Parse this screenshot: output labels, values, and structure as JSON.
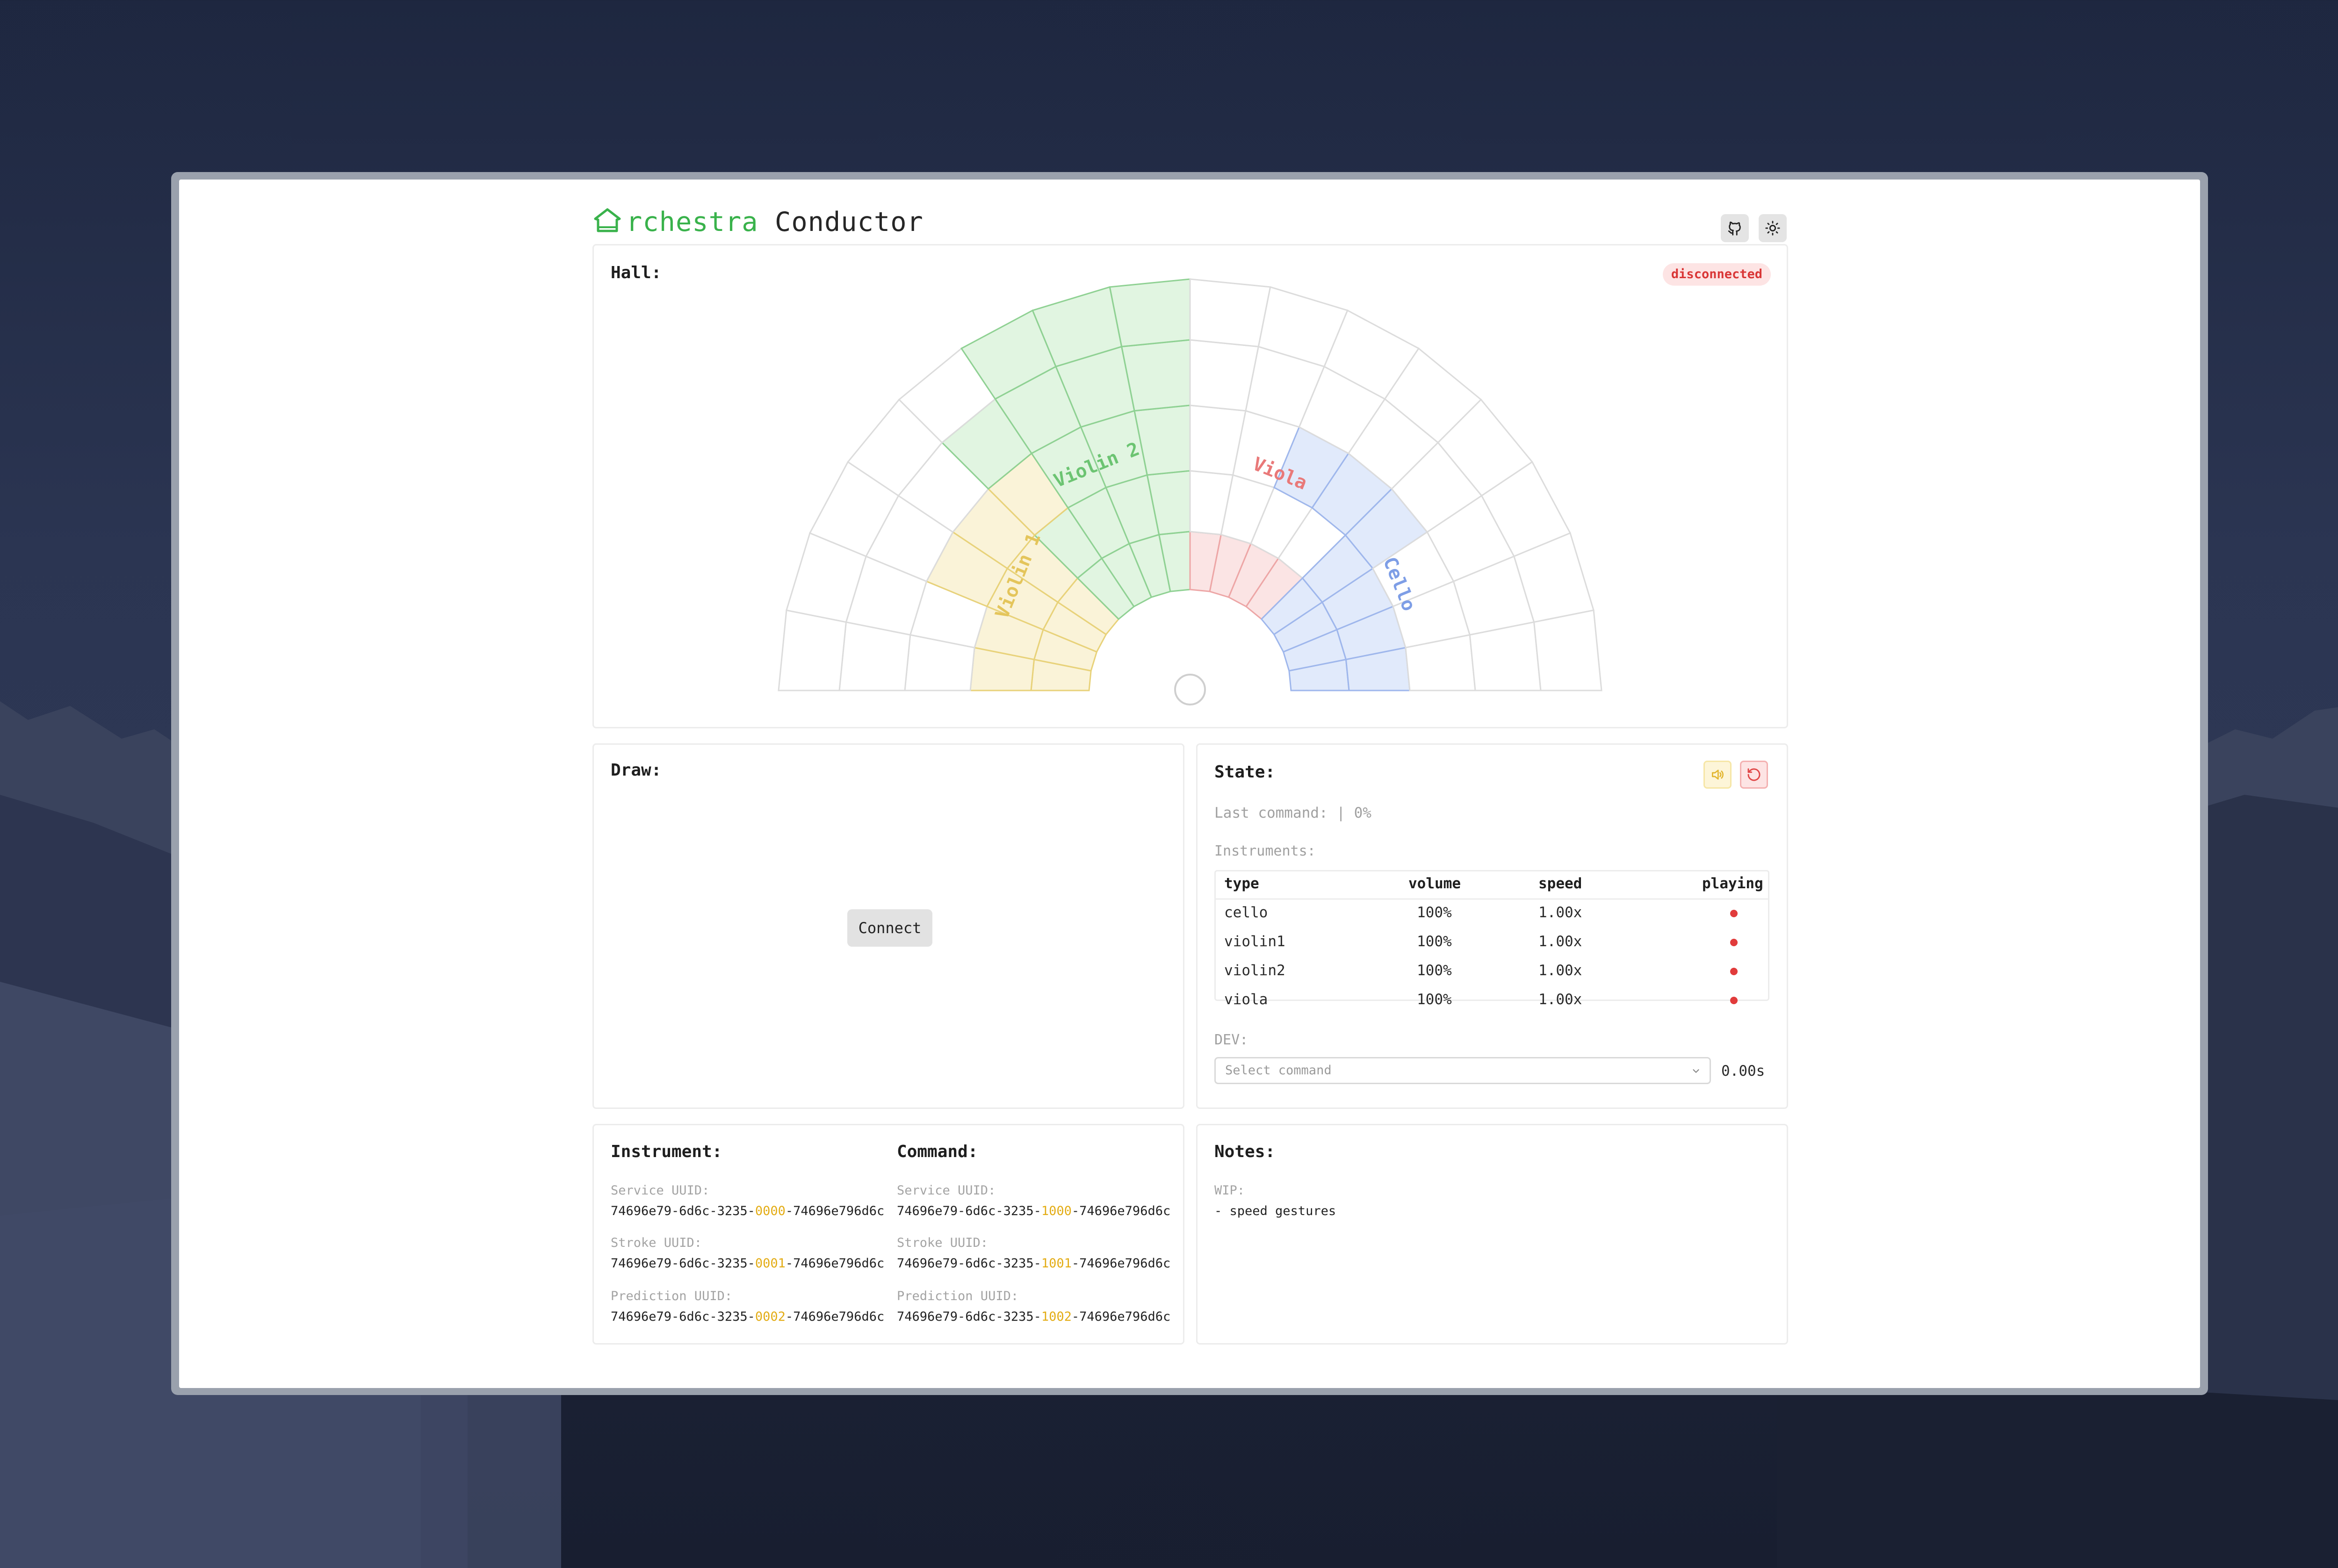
{
  "header": {
    "brand_highlight": "rchestra",
    "brand_rest": "Conductor",
    "github_icon": "github-icon",
    "theme_icon": "sun-icon"
  },
  "hall": {
    "title": "Hall:",
    "status": "disconnected",
    "sections": [
      {
        "name": "Violin 1",
        "color": "#f5e9b8"
      },
      {
        "name": "Violin 2",
        "color": "#c8ecc9"
      },
      {
        "name": "Viola",
        "color": "#f8cdcd"
      },
      {
        "name": "Cello",
        "color": "#c9d8f7"
      }
    ]
  },
  "draw": {
    "title": "Draw:",
    "connect_label": "Connect"
  },
  "state": {
    "title": "State:",
    "last_command": "Last command:  | 0%",
    "instruments_label": "Instruments:",
    "columns": [
      "type",
      "volume",
      "speed",
      "playing"
    ],
    "rows": [
      {
        "type": "cello",
        "volume": "100%",
        "speed": "1.00x",
        "playing": false
      },
      {
        "type": "violin1",
        "volume": "100%",
        "speed": "1.00x",
        "playing": false
      },
      {
        "type": "violin2",
        "volume": "100%",
        "speed": "1.00x",
        "playing": false
      },
      {
        "type": "viola",
        "volume": "100%",
        "speed": "1.00x",
        "playing": false
      }
    ],
    "dev_label": "DEV:",
    "select_placeholder": "Select command",
    "timer": "0.00s"
  },
  "instrument": {
    "title": "Instrument:",
    "service_label": "Service UUID:",
    "service": {
      "pre": "74696e79-6d6c-3235-",
      "hl": "0000",
      "post": "-74696e796d6c"
    },
    "stroke_label": "Stroke UUID:",
    "stroke": {
      "pre": "74696e79-6d6c-3235-",
      "hl": "0001",
      "post": "-74696e796d6c"
    },
    "prediction_label": "Prediction UUID:",
    "prediction": {
      "pre": "74696e79-6d6c-3235-",
      "hl": "0002",
      "post": "-74696e796d6c"
    }
  },
  "command": {
    "title": "Command:",
    "service_label": "Service UUID:",
    "service": {
      "pre": "74696e79-6d6c-3235-",
      "hl": "1000",
      "post": "-74696e796d6c"
    },
    "stroke_label": "Stroke UUID:",
    "stroke": {
      "pre": "74696e79-6d6c-3235-",
      "hl": "1001",
      "post": "-74696e796d6c"
    },
    "prediction_label": "Prediction UUID:",
    "prediction": {
      "pre": "74696e79-6d6c-3235-",
      "hl": "1002",
      "post": "-74696e796d6c"
    }
  },
  "notes": {
    "title": "Notes:",
    "wip_label": "WIP:",
    "items": [
      "- speed gestures"
    ]
  }
}
